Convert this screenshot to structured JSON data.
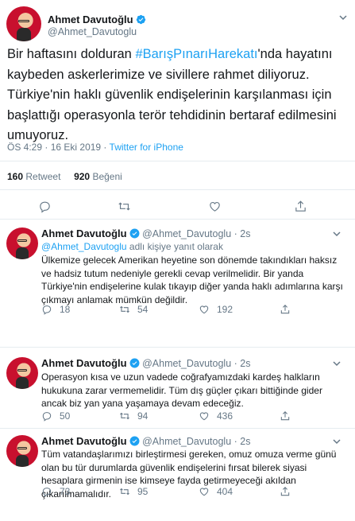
{
  "colors": {
    "accent": "#1da1f2",
    "secondary_text": "#657786",
    "primary_text": "#14171a",
    "divider": "#e6ecf0"
  },
  "main_tweet": {
    "name": "Ahmet Davutoğlu",
    "handle": "@Ahmet_Davutoglu",
    "text_before": "Bir haftasını dolduran ",
    "hashtag": "#BarışPınarıHarekatı",
    "text_after": "'nda hayatını kaybeden askerlerimize ve sivillere rahmet diliyoruz. Türkiye'nin haklı güvenlik endişelerinin karşılanması için başlattığı operasyonla terör tehdidinin bertaraf edilmesini umuyoruz.",
    "time": "ÖS 4:29",
    "date": "16 Eki 2019",
    "source": "Twitter for iPhone",
    "retweets": "160",
    "retweets_label": "Retweet",
    "likes": "920",
    "likes_label": "Beğeni"
  },
  "replies": [
    {
      "name": "Ahmet Davutoğlu",
      "handle": "@Ahmet_Davutoglu",
      "time": "2s",
      "reply_to_handle": "@Ahmet_Davutoglu",
      "reply_to_text": "adlı kişiye yanıt olarak",
      "text": "Ülkemize gelecek Amerikan heyetine son dönemde takındıkları haksız ve hadsiz tutum nedeniyle gerekli cevap verilmelidir. Bir yanda Türkiye'nin endişelerine kulak tıkayıp diğer yanda haklı adımlarına karşı çıkmayı anlamak mümkün değildir.",
      "replies": "18",
      "retweets": "54",
      "likes": "192"
    },
    {
      "name": "Ahmet Davutoğlu",
      "handle": "@Ahmet_Davutoglu",
      "time": "2s",
      "text": "Operasyon kısa ve uzun vadede coğrafyamızdaki kardeş halkların hukukuna zarar vermemelidir. Tüm dış güçler çıkarı bittiğinde gider ancak biz yan yana yaşamaya devam edeceğiz.",
      "replies": "50",
      "retweets": "94",
      "likes": "436"
    },
    {
      "name": "Ahmet Davutoğlu",
      "handle": "@Ahmet_Davutoglu",
      "time": "2s",
      "text": "Tüm vatandaşlarımızı birleştirmesi gereken, omuz omuza verme günü olan bu tür durumlarda güvenlik endişelerini fırsat bilerek siyasi hesaplara girmenin ise kimseye fayda getirmeyeceği akıldan çıkarılmamalıdır.",
      "replies": "73",
      "retweets": "95",
      "likes": "404"
    }
  ],
  "icons": [
    "reply-icon",
    "retweet-icon",
    "like-icon",
    "share-icon",
    "verified-badge-icon",
    "caret-down-icon"
  ]
}
